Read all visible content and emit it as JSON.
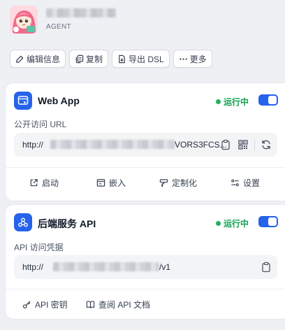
{
  "app": {
    "type_label": "AGENT"
  },
  "actions": [
    {
      "label": "编辑信息",
      "icon": "edit-icon"
    },
    {
      "label": "复制",
      "icon": "copy-icon"
    },
    {
      "label": "导出 DSL",
      "icon": "export-icon"
    },
    {
      "label": "更多",
      "icon": "more-icon"
    }
  ],
  "webapp": {
    "title": "Web App",
    "status": "运行中",
    "enabled": true,
    "url_label": "公开访问 URL",
    "url_prefix": "http://",
    "url_suffix": "VORS3FCS...",
    "links": [
      {
        "label": "启动",
        "icon": "launch-icon"
      },
      {
        "label": "嵌入",
        "icon": "embed-icon"
      },
      {
        "label": "定制化",
        "icon": "customize-icon"
      },
      {
        "label": "设置",
        "icon": "settings-icon"
      }
    ]
  },
  "api": {
    "title": "后端服务 API",
    "status": "运行中",
    "enabled": true,
    "credential_label": "API 访问凭据",
    "url_prefix": "http://",
    "url_suffix": "/v1",
    "links": [
      {
        "label": "API 密钥",
        "icon": "key-icon"
      },
      {
        "label": "查阅 API 文档",
        "icon": "book-icon"
      }
    ]
  },
  "colors": {
    "accent": "#2563eb",
    "status_green": "#12a150",
    "background": "#eef0f4"
  }
}
